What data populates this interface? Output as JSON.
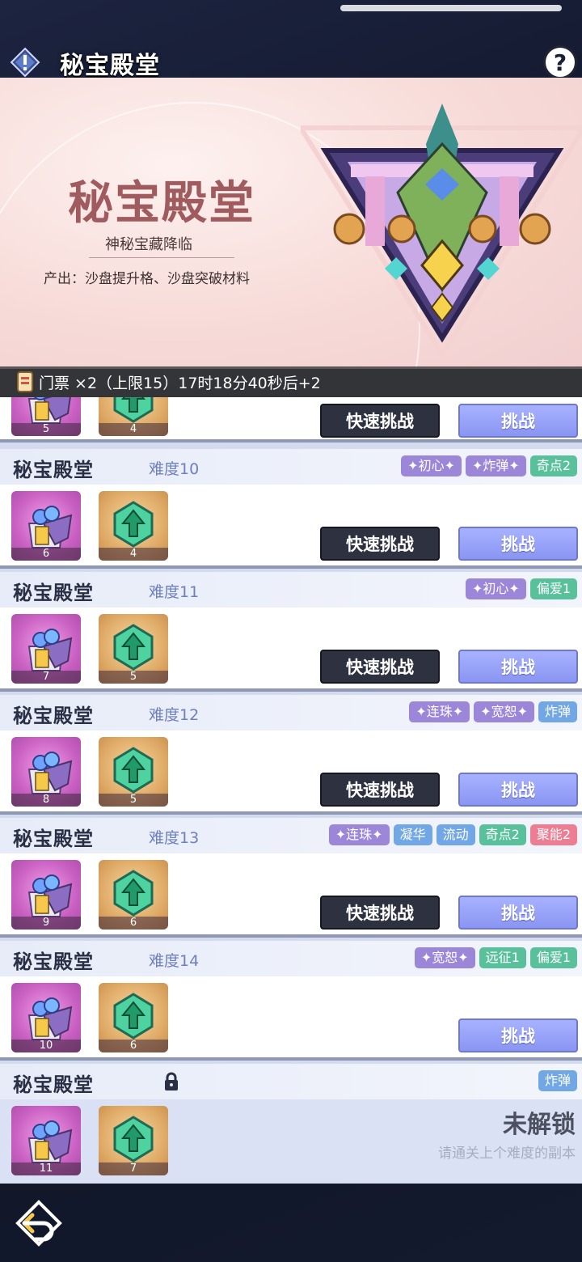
{
  "header": {
    "title": "秘宝殿堂",
    "help_label": "?"
  },
  "banner": {
    "title": "秘宝殿堂",
    "subtitle": "神秘宝藏降临",
    "desc": "产出：沙盘提升格、沙盘突破材料"
  },
  "ticket": {
    "text": "门票 ×2（上限15）17时18分40秒后+2"
  },
  "buttons": {
    "quick": "快速挑战",
    "challenge": "挑战"
  },
  "partial_card": {
    "reward1_count": "5",
    "reward2_count": "4"
  },
  "cards": [
    {
      "name": "秘宝殿堂",
      "level": "难度10",
      "tags": [
        "✦初心✦",
        "✦炸弹✦",
        "奇点2"
      ],
      "tag_colors": [
        "purple",
        "purple",
        "green"
      ],
      "reward1_count": "6",
      "reward2_count": "4",
      "quick": true
    },
    {
      "name": "秘宝殿堂",
      "level": "难度11",
      "tags": [
        "✦初心✦",
        "偏爱1"
      ],
      "tag_colors": [
        "purple",
        "green"
      ],
      "reward1_count": "7",
      "reward2_count": "5",
      "quick": true
    },
    {
      "name": "秘宝殿堂",
      "level": "难度12",
      "tags": [
        "✦连珠✦",
        "✦宽恕✦",
        "炸弹"
      ],
      "tag_colors": [
        "purple",
        "purple",
        "blue"
      ],
      "reward1_count": "8",
      "reward2_count": "5",
      "quick": true
    },
    {
      "name": "秘宝殿堂",
      "level": "难度13",
      "tags": [
        "✦连珠✦",
        "凝华",
        "流动",
        "奇点2",
        "聚能2"
      ],
      "tag_colors": [
        "purple",
        "blue",
        "blue",
        "green",
        "red"
      ],
      "reward1_count": "9",
      "reward2_count": "6",
      "quick": true
    },
    {
      "name": "秘宝殿堂",
      "level": "难度14",
      "tags": [
        "✦宽恕✦",
        "远征1",
        "偏爱1"
      ],
      "tag_colors": [
        "purple",
        "green",
        "green"
      ],
      "reward1_count": "10",
      "reward2_count": "6",
      "quick": false
    }
  ],
  "locked_card": {
    "name": "秘宝殿堂",
    "tag": "炸弹",
    "reward1_count": "11",
    "reward2_count": "7",
    "locked_title": "未解锁",
    "locked_hint": "请通关上个难度的副本"
  }
}
